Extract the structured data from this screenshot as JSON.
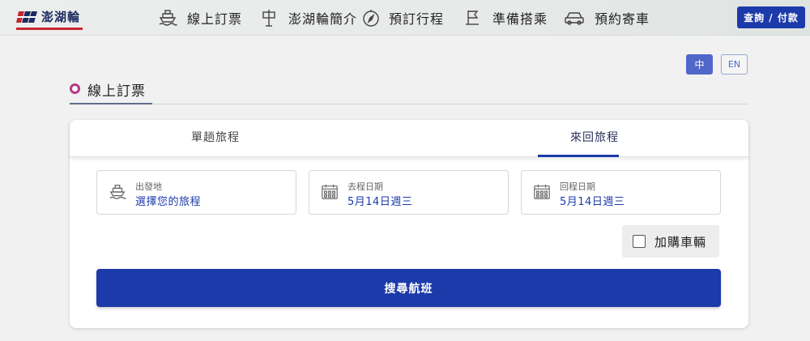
{
  "brand": {
    "name": "澎湖輪"
  },
  "nav": {
    "items": [
      {
        "label": "線上訂票",
        "icon": "ship-icon"
      },
      {
        "label": "澎湖輪簡介",
        "icon": "signpost-icon"
      },
      {
        "label": "預訂行程",
        "icon": "compass-icon"
      },
      {
        "label": "準備搭乘",
        "icon": "flag-icon"
      },
      {
        "label": "預約寄車",
        "icon": "car-icon"
      }
    ],
    "query_button": "查詢 / 付款"
  },
  "lang": {
    "zh": "中",
    "en": "EN",
    "active": "zh"
  },
  "section": {
    "title": "線上訂票"
  },
  "tabs": [
    {
      "label": "單趟旅程",
      "active": false
    },
    {
      "label": "來回旅程",
      "active": true
    }
  ],
  "form": {
    "origin": {
      "label": "出發地",
      "value": "選擇您的旅程",
      "icon": "ship-icon"
    },
    "depart": {
      "label": "去程日期",
      "value": "5月14日週三",
      "icon": "calendar-icon"
    },
    "return": {
      "label": "回程日期",
      "value": "5月14日週三",
      "icon": "calendar-icon"
    },
    "add_vehicle": {
      "label": "加購車輛",
      "checked": false
    },
    "search_button": "搜尋航班"
  },
  "colors": {
    "primary": "#1c3aa9",
    "accent": "#b53a86",
    "brand_red": "#c9262d"
  }
}
